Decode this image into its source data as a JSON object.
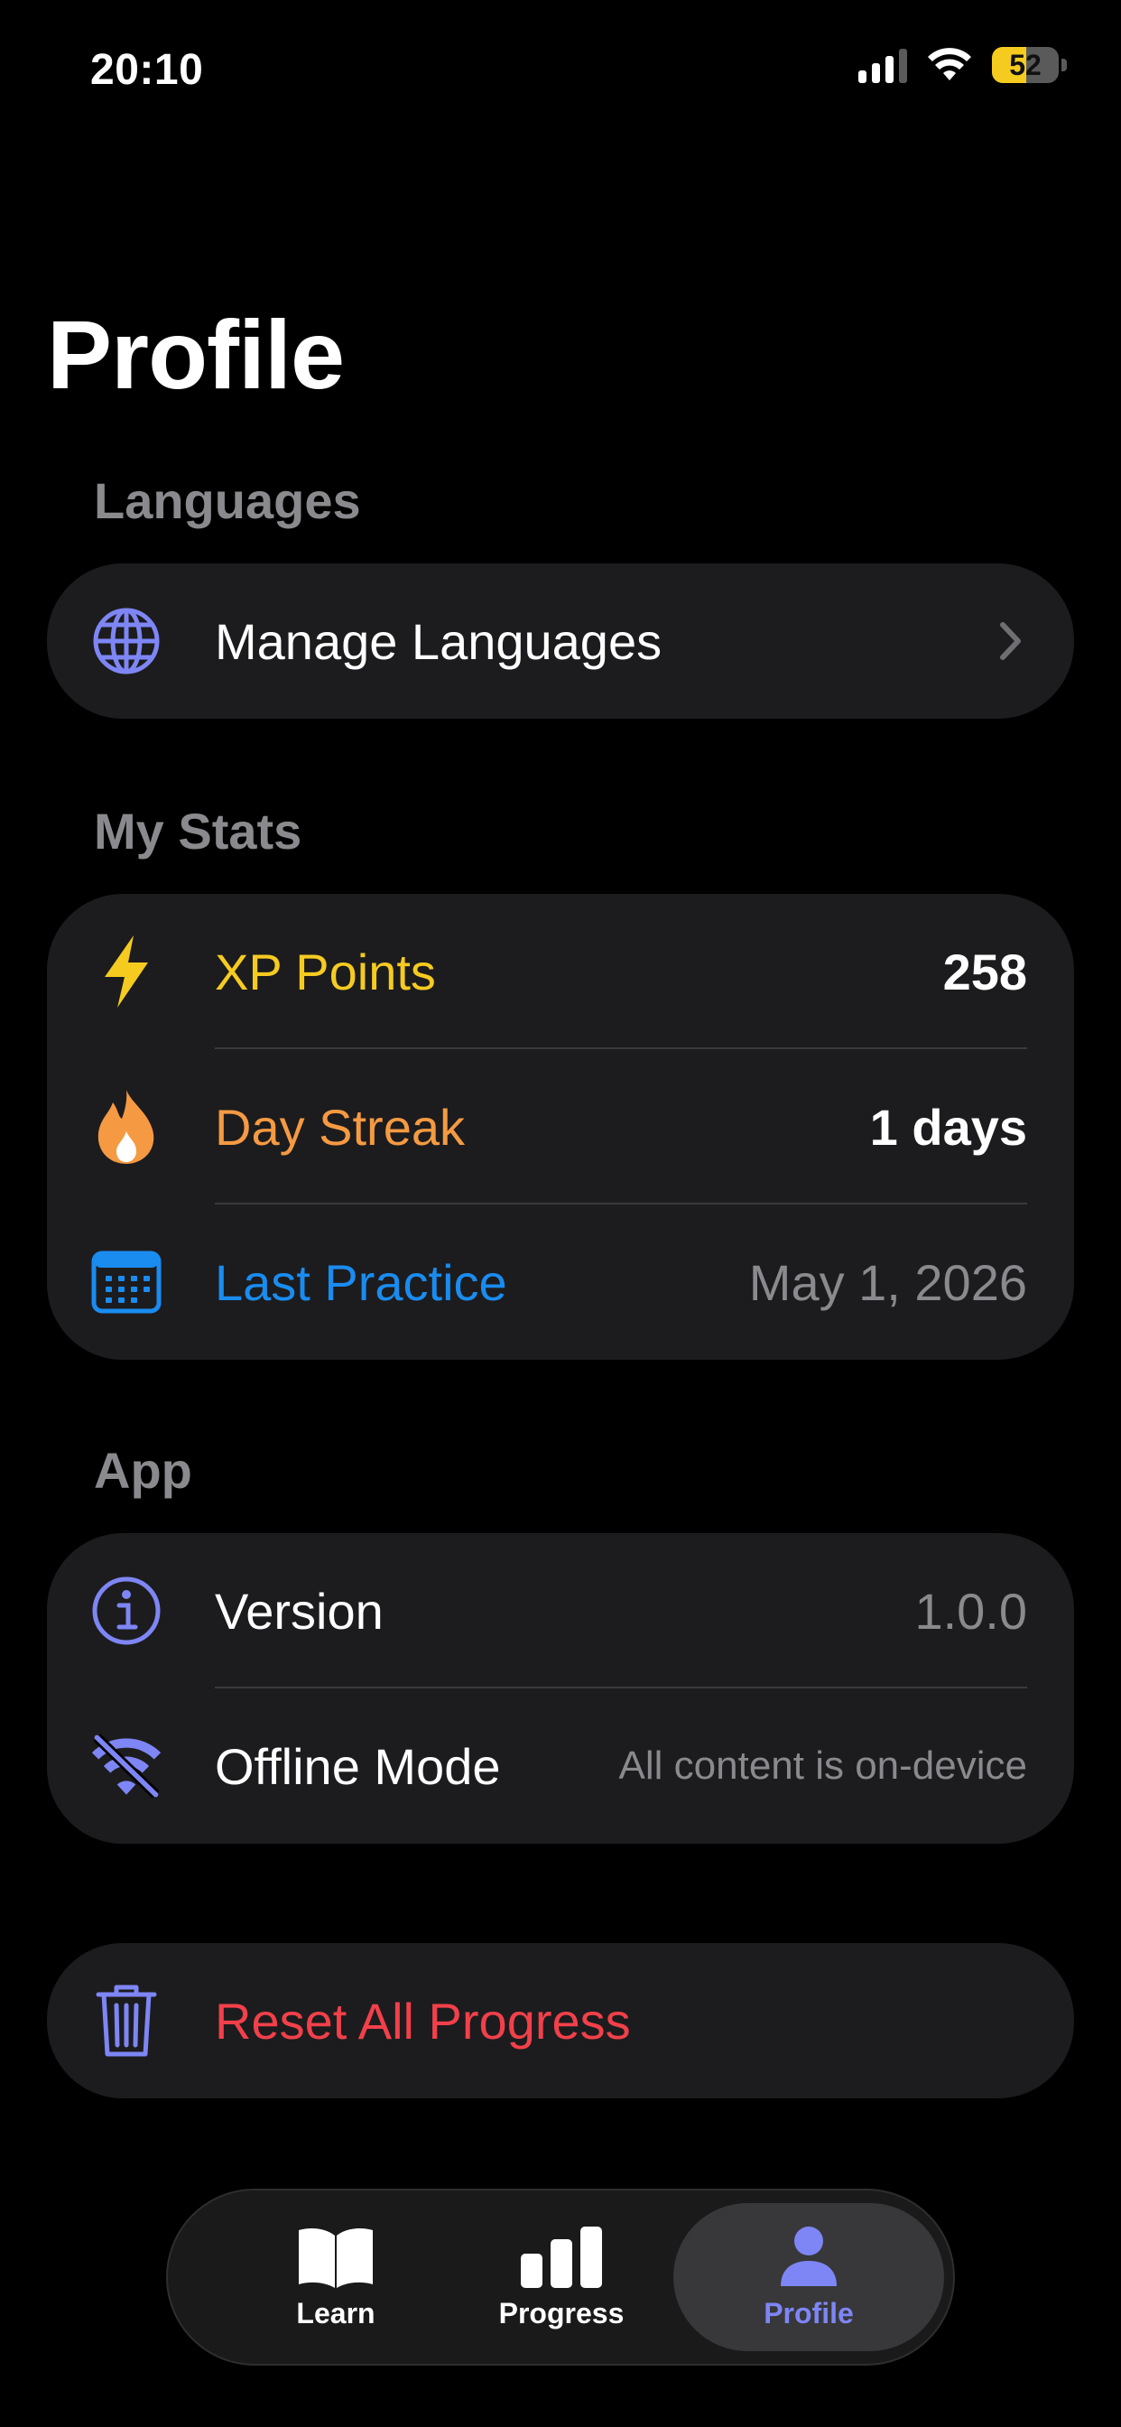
{
  "status_bar": {
    "time": "20:10",
    "battery": "52",
    "battery_level": 0.52,
    "icons": [
      "cellular-signal-icon",
      "wifi-icon",
      "battery-icon"
    ]
  },
  "title": "Profile",
  "sections": {
    "languages": {
      "header": "Languages",
      "manage_label": "Manage Languages",
      "icon": "globe-icon"
    },
    "stats": {
      "header": "My Stats",
      "xp_label": "XP Points",
      "xp_value": "258",
      "streak_label": "Day Streak",
      "streak_value": "1 days",
      "last_practice_label": "Last Practice",
      "last_practice_value": "May 1, 2026",
      "icons": [
        "bolt-icon",
        "flame-icon",
        "calendar-icon"
      ]
    },
    "app": {
      "header": "App",
      "version_label": "Version",
      "version_value": "1.0.0",
      "offline_label": "Offline Mode",
      "offline_value": "All content is on-device",
      "icons": [
        "info-icon",
        "wifi-off-icon"
      ]
    },
    "danger": {
      "reset_label": "Reset All Progress",
      "icon": "trash-icon"
    }
  },
  "tab_bar": {
    "tabs": [
      {
        "label": "Learn",
        "icon": "book-icon"
      },
      {
        "label": "Progress",
        "icon": "bar-chart-icon"
      },
      {
        "label": "Profile",
        "icon": "person-icon"
      }
    ],
    "active": "Profile"
  },
  "colors": {
    "accent": "#7e86f5",
    "xp": "#f6cb20",
    "streak": "#f59a42",
    "last_practice": "#1a8cf0",
    "destructive": "#f2404a",
    "secondary_text": "#8a8a8e",
    "card": "#1c1c1e"
  }
}
